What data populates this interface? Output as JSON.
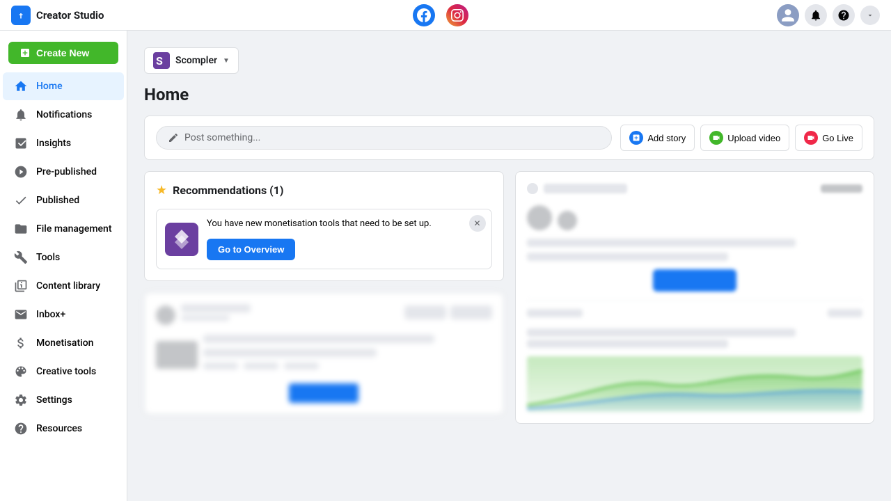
{
  "app": {
    "title": "Creator Studio"
  },
  "topbar": {
    "fb_platform_label": "Facebook",
    "ig_platform_label": "Instagram",
    "avatar_label": "User Avatar",
    "notifications_label": "Notifications",
    "help_label": "Help",
    "more_label": "More"
  },
  "account_selector": {
    "name": "Scompler",
    "dropdown_label": "Switch account"
  },
  "create_new": {
    "label": "Create New"
  },
  "sidebar": {
    "items": [
      {
        "id": "home",
        "label": "Home",
        "active": true
      },
      {
        "id": "notifications",
        "label": "Notifications",
        "active": false
      },
      {
        "id": "insights",
        "label": "Insights",
        "active": false
      },
      {
        "id": "pre-published",
        "label": "Pre-published",
        "active": false
      },
      {
        "id": "published",
        "label": "Published",
        "active": false
      },
      {
        "id": "file-management",
        "label": "File management",
        "active": false
      },
      {
        "id": "tools",
        "label": "Tools",
        "active": false
      },
      {
        "id": "content-library",
        "label": "Content library",
        "active": false
      },
      {
        "id": "inbox",
        "label": "Inbox+",
        "active": false
      },
      {
        "id": "monetisation",
        "label": "Monetisation",
        "active": false
      },
      {
        "id": "creative-tools",
        "label": "Creative tools",
        "active": false
      },
      {
        "id": "settings",
        "label": "Settings",
        "active": false
      },
      {
        "id": "resources",
        "label": "Resources",
        "active": false
      }
    ]
  },
  "main": {
    "title": "Home",
    "post_placeholder": "Post something...",
    "add_story_label": "Add story",
    "upload_video_label": "Upload video",
    "go_live_label": "Go Live"
  },
  "recommendations": {
    "title": "Recommendations (1)",
    "item": {
      "text": "You have new monetisation tools that need to be set up.",
      "cta_label": "Go to Overview"
    }
  }
}
